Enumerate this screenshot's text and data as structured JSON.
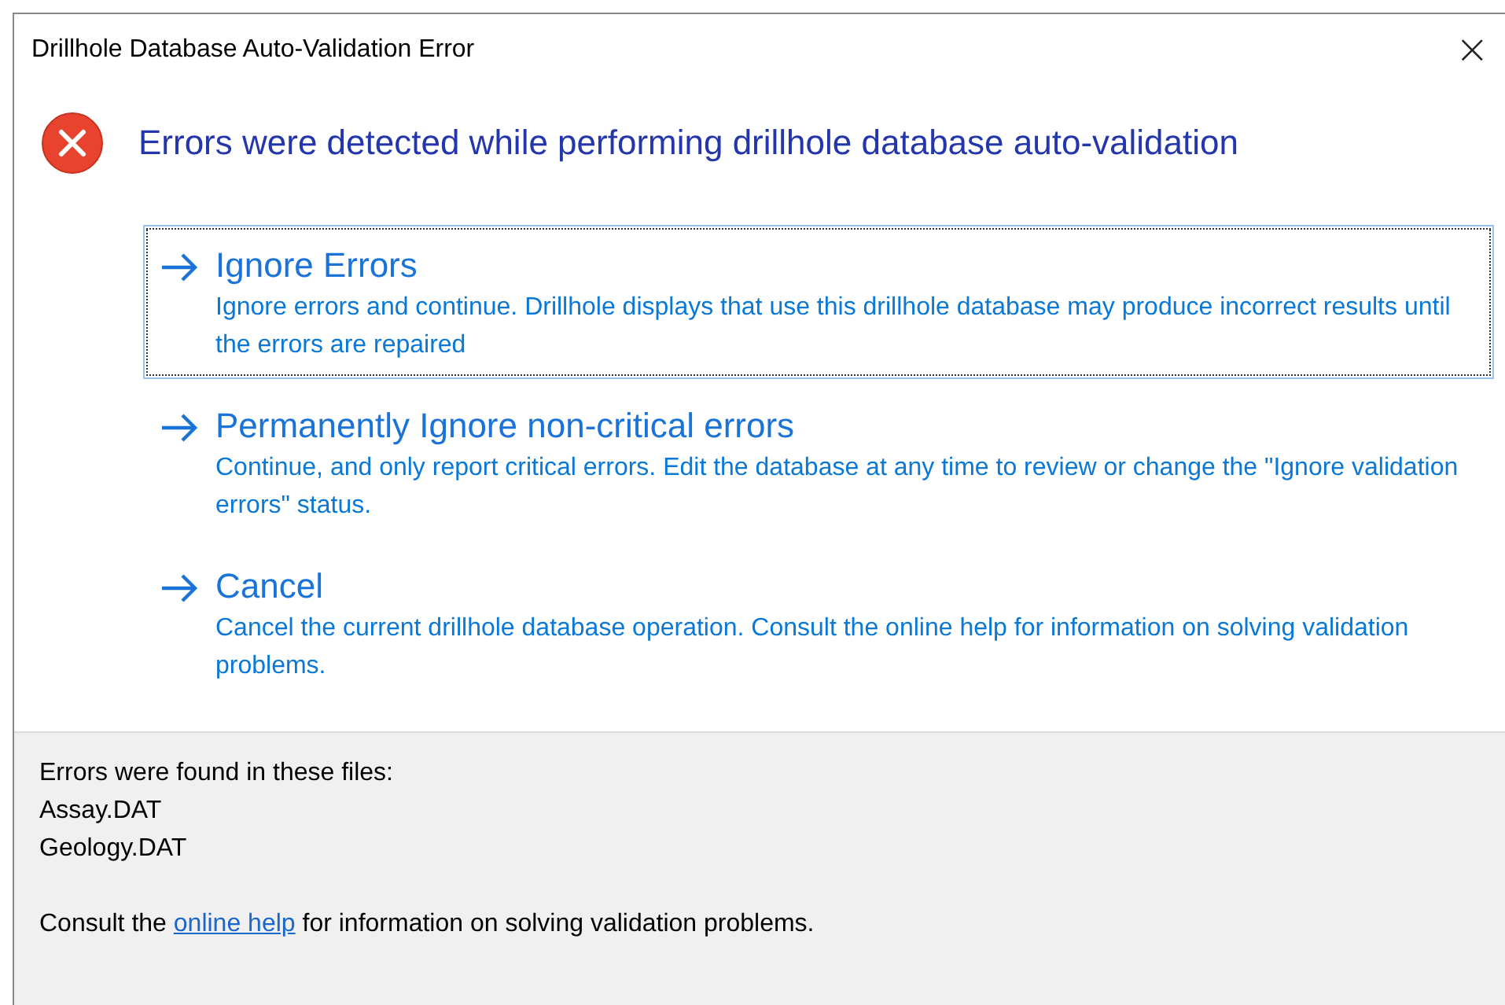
{
  "window": {
    "title": "Drillhole Database Auto-Validation Error",
    "close": "×"
  },
  "heading": "Errors were detected while performing drillhole database auto-validation",
  "command_links": [
    {
      "title": "Ignore Errors",
      "description": "Ignore errors and continue. Drillhole displays that use this drillhole database may produce incorrect results until the errors are repaired",
      "selected": true
    },
    {
      "title": "Permanently Ignore non-critical errors",
      "description": "Continue, and only report critical errors. Edit the database at any time to review or change the \"Ignore validation errors\" status.",
      "selected": false
    },
    {
      "title": "Cancel",
      "description": "Cancel the current drillhole database operation. Consult the online help for information on solving validation problems.",
      "selected": false
    }
  ],
  "footer": {
    "intro": "Errors were found in these files:",
    "files": [
      "Assay.DAT",
      "Geology.DAT"
    ],
    "help": {
      "before": "Consult the ",
      "link": "online help",
      "after": " for information on solving validation problems."
    }
  }
}
